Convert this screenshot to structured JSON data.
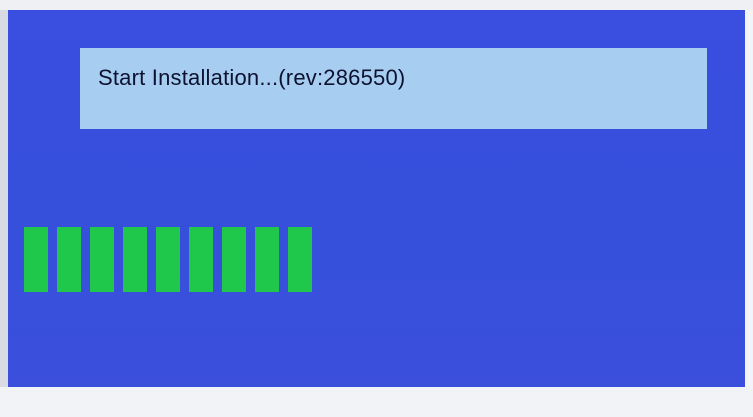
{
  "install": {
    "message": "Start Installation...(rev:286550)",
    "progress": {
      "filled_blocks": 9
    }
  },
  "colors": {
    "background": "#3650db",
    "message_box": "#a7cdf0",
    "progress_block": "#1fc74a"
  }
}
